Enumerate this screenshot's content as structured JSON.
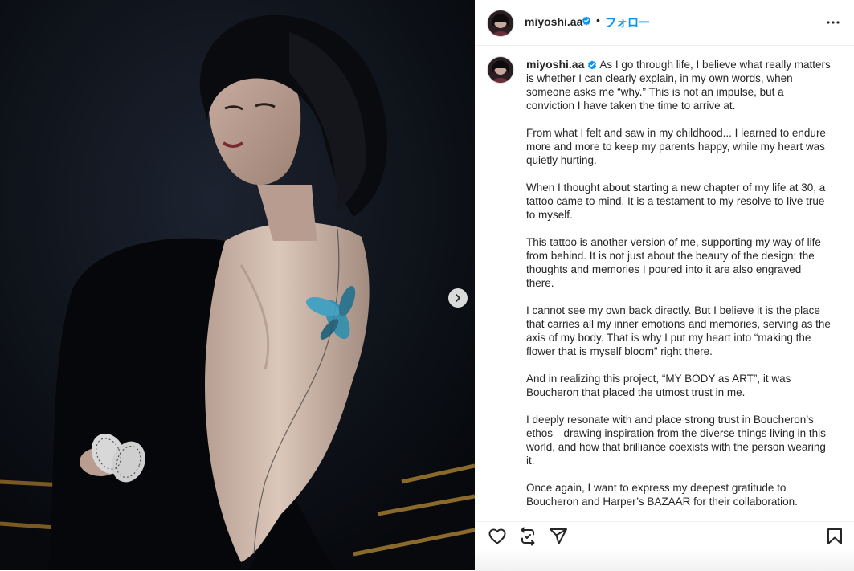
{
  "post": {
    "username": "miyoshi.aa",
    "separator": "•",
    "follow_label": "フォロー",
    "caption_paragraphs": [
      "From what I felt and saw in my childhood... I learned to endure more and more to keep my parents happy, while my heart was quietly hurting.",
      "When I thought about starting a new chapter of my life at 30, a tattoo came to mind. It is a testament to my resolve to live true to myself.",
      "This tattoo is another version of me, supporting my way of life from behind. It is not just about the beauty of the design; the thoughts and memories I poured into it are also engraved there.",
      "I cannot see my own back directly. But I believe it is the place that carries all my inner emotions and memories, serving as the axis of my body. That is why I put my heart into “making the flower that is myself bloom” right there.",
      "And in realizing this project, “MY BODY as ART”, it was Boucheron that placed the utmost trust in me.",
      "I deeply resonate with and place strong trust in Boucheron’s ethos—drawing inspiration from the diverse things living in this world, and how that brilliance coexists with the person wearing it.",
      "Once again, I want to express my deepest gratitude to Boucheron and Harper’s BAZAAR for their collaboration."
    ],
    "caption_first": "As I go through life, I believe what really matters is whether I can clearly explain, in my own words, when someone asks me “why.”  This is not an impulse, but a conviction I have taken the time to arrive at."
  },
  "colors": {
    "verified": "#0095f6",
    "follow": "#0095f6",
    "tattoo": "#2f8fb0"
  },
  "icons": {
    "like": "heart-icon",
    "repost": "repost-icon",
    "share": "paper-plane-icon",
    "save": "bookmark-icon",
    "more": "more-horizontal-icon",
    "next": "chevron-right-icon"
  }
}
